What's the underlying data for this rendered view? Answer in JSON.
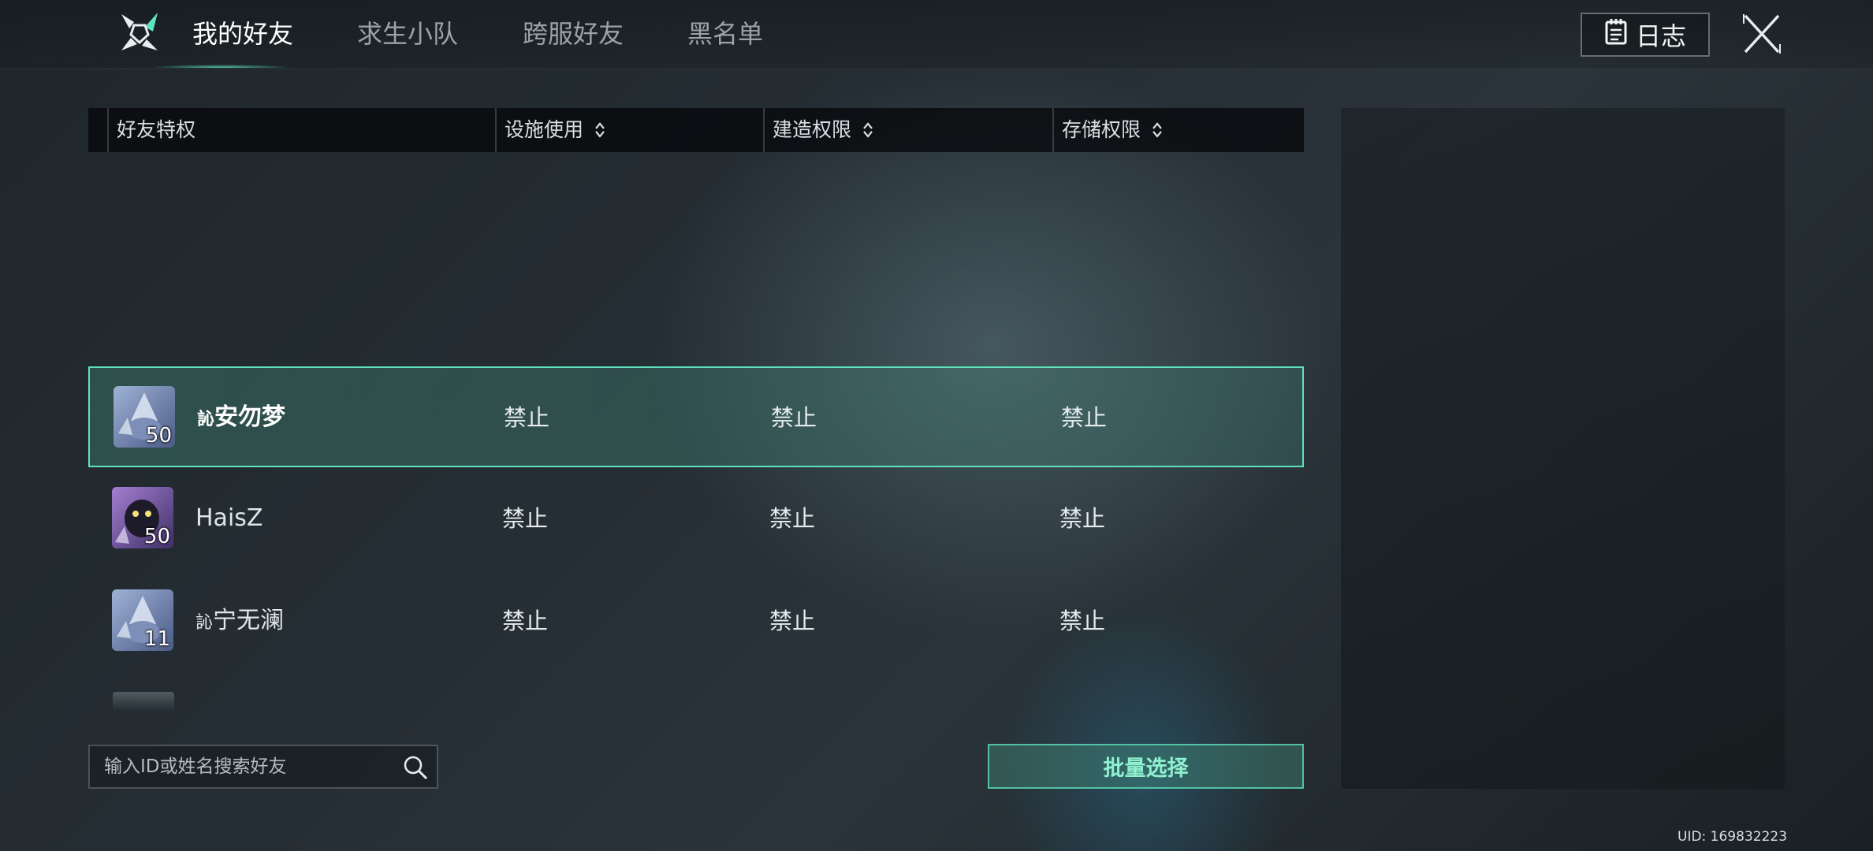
{
  "tabs": [
    {
      "label": "我的好友",
      "active": true
    },
    {
      "label": "求生小队",
      "active": false
    },
    {
      "label": "跨服好友",
      "active": false
    },
    {
      "label": "黑名单",
      "active": false
    }
  ],
  "log_button": {
    "label": "日志",
    "icon": "notepad-icon"
  },
  "close_button": {
    "icon": "close-icon"
  },
  "table": {
    "headers": [
      "好友特权",
      "设施使用",
      "建造权限",
      "存储权限"
    ],
    "rows": [
      {
        "name": "安勿梦",
        "name_prefix": "訫",
        "level": "50",
        "facility": "禁止",
        "build": "禁止",
        "storage": "禁止",
        "selected": true
      },
      {
        "name": "HaisZ",
        "name_prefix": "",
        "level": "50",
        "facility": "禁止",
        "build": "禁止",
        "storage": "禁止",
        "selected": false
      },
      {
        "name": "宁无澜",
        "name_prefix": "訫",
        "level": "11",
        "facility": "禁止",
        "build": "禁止",
        "storage": "禁止",
        "selected": false
      }
    ]
  },
  "search": {
    "placeholder": "输入ID或姓名搜索好友",
    "value": ""
  },
  "batch_button": {
    "label": "批量选择"
  },
  "uid": "UID: 169832223",
  "colors": {
    "accent": "#5fe3bc",
    "background": "#252e34"
  }
}
